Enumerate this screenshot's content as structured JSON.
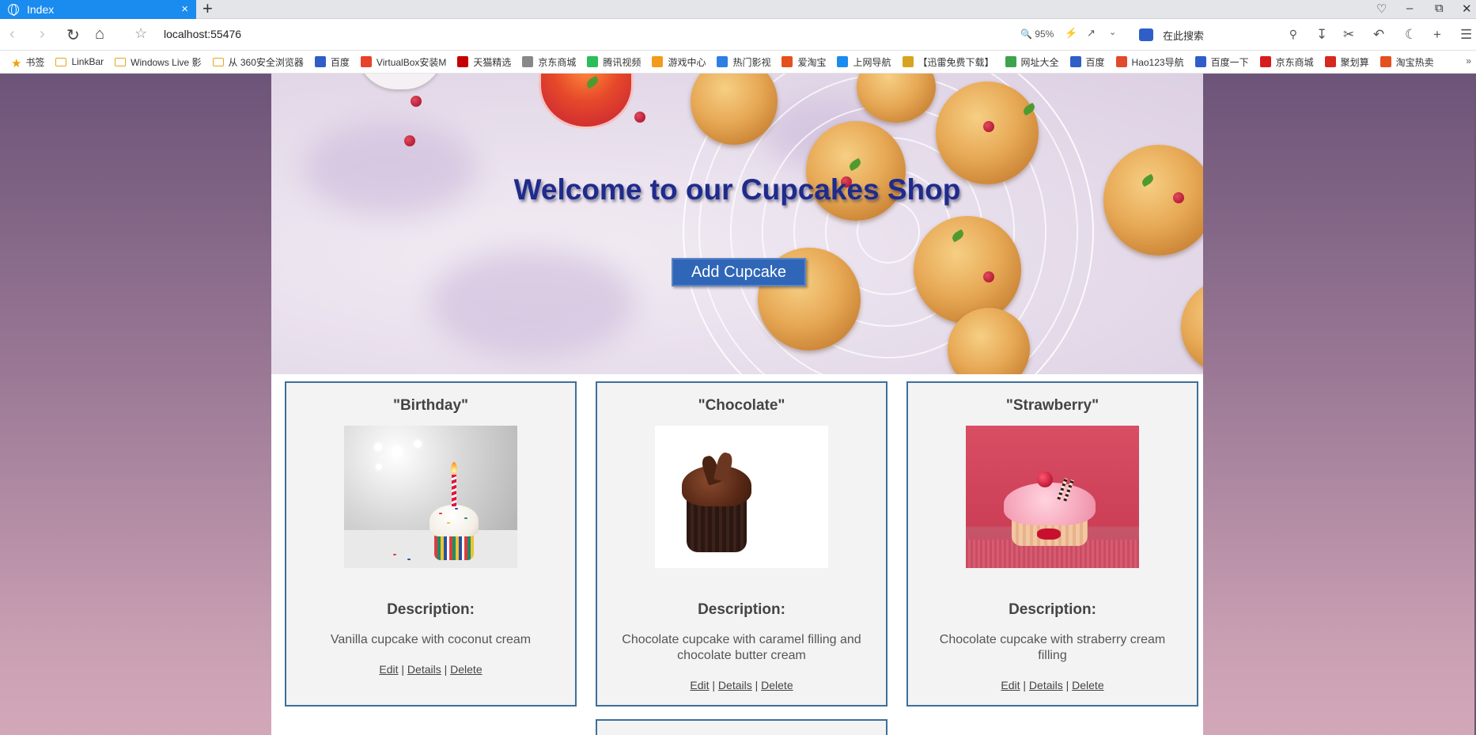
{
  "browser": {
    "tab_title": "Index",
    "tab_close": "×",
    "new_tab": "+",
    "url": "localhost:55476",
    "zoom": "95%",
    "search_placeholder": "在此搜索",
    "more": "»"
  },
  "bookmarks": [
    {
      "label": "书签",
      "icon": "star-icon"
    },
    {
      "label": "LinkBar",
      "icon": "folder-icon"
    },
    {
      "label": "Windows Live 影",
      "icon": "folder-icon"
    },
    {
      "label": "从 360安全浏览器",
      "icon": "folder-icon"
    },
    {
      "label": "百度",
      "icon": "baidu-icon"
    },
    {
      "label": "VirtualBox安装M",
      "icon": "c-icon"
    },
    {
      "label": "天猫精选",
      "icon": "tmall-icon"
    },
    {
      "label": "京东商城",
      "icon": "globe-icon"
    },
    {
      "label": "腾讯视频",
      "icon": "play-icon"
    },
    {
      "label": "游戏中心",
      "icon": "game-icon"
    },
    {
      "label": "热门影视",
      "icon": "video-icon"
    },
    {
      "label": "爱淘宝",
      "icon": "taobao-icon"
    },
    {
      "label": "上网导航",
      "icon": "q-icon"
    },
    {
      "label": "【迅雷免费下载】",
      "icon": "thunder-icon"
    },
    {
      "label": "网址大全",
      "icon": "hao-icon"
    },
    {
      "label": "百度",
      "icon": "baidu-icon"
    },
    {
      "label": "Hao123导航",
      "icon": "hao123-icon"
    },
    {
      "label": "百度一下",
      "icon": "baidu-icon"
    },
    {
      "label": "京东商城",
      "icon": "jd-icon"
    },
    {
      "label": "聚划算",
      "icon": "juhuasuan-icon"
    },
    {
      "label": "淘宝热卖",
      "icon": "taobao-icon"
    }
  ],
  "page": {
    "hero_title": "Welcome to our Cupcakes Shop",
    "add_button": "Add Cupcake",
    "description_heading": "Description:",
    "link_edit": "Edit",
    "link_details": "Details",
    "link_delete": "Delete",
    "separator": "|"
  },
  "cupcakes": [
    {
      "name": "\"Birthday\"",
      "description": "Vanilla cupcake with coconut cream",
      "image": "birthday-cupcake-image"
    },
    {
      "name": "\"Chocolate\"",
      "description": "Chocolate cupcake with caramel filling and chocolate butter cream",
      "image": "chocolate-cupcake-image"
    },
    {
      "name": "\"Strawberry\"",
      "description": "Chocolate cupcake with straberry cream filling",
      "image": "strawberry-cupcake-image"
    }
  ],
  "colors": {
    "accent": "#1a8cf0",
    "button": "#2f66b8",
    "title": "#1f2b8c",
    "card_border": "#3f6f99"
  }
}
